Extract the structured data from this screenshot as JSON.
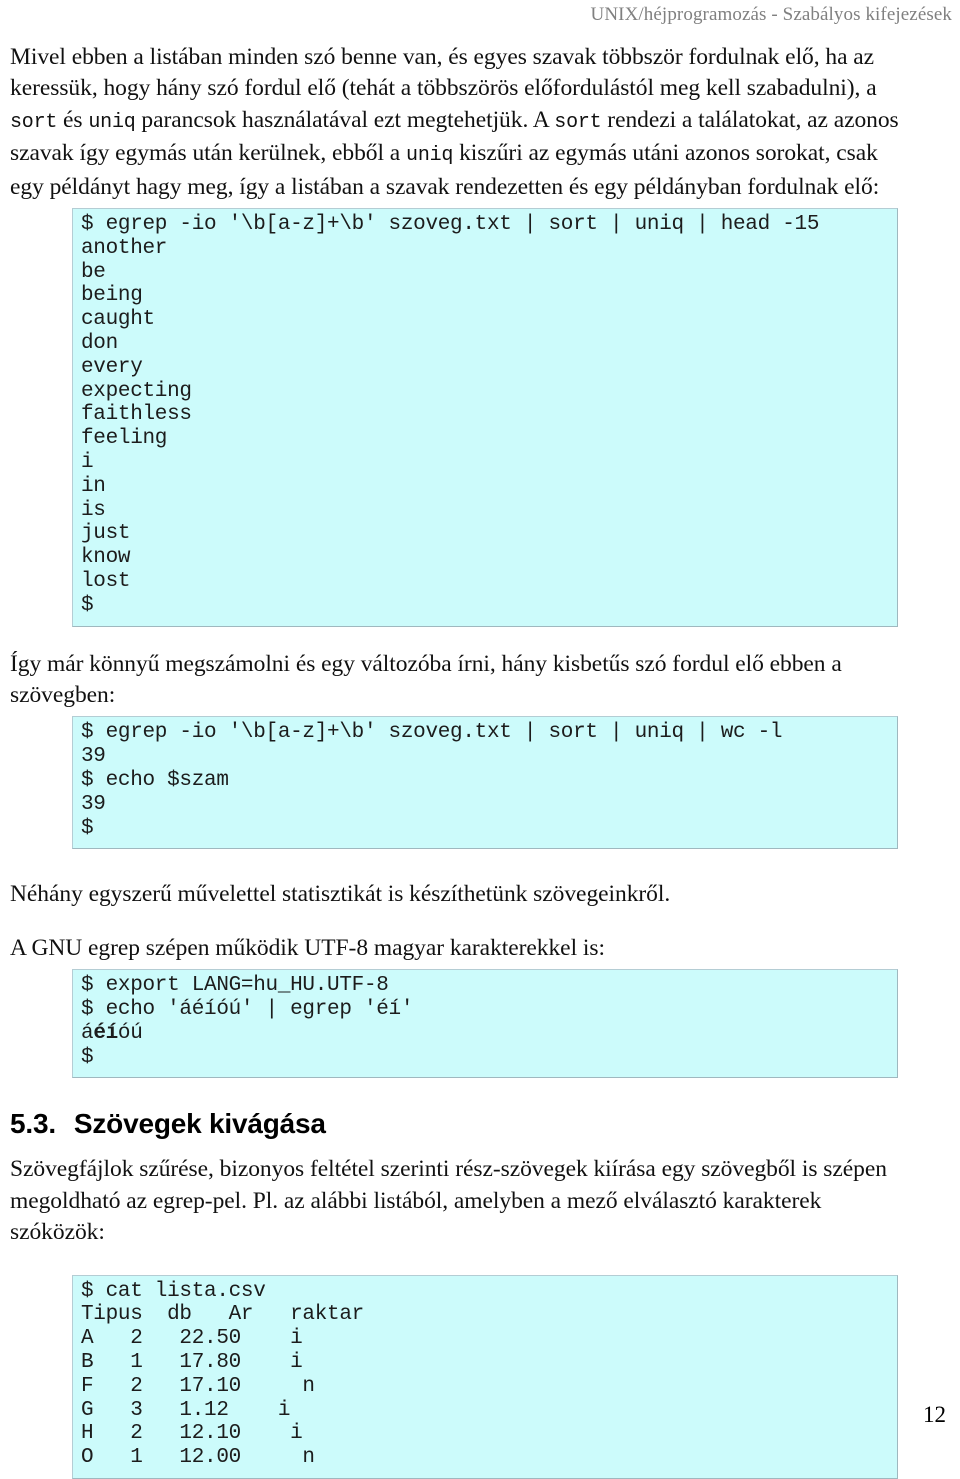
{
  "header": {
    "running_title": "UNIX/héjprogramozás - Szabályos kifejezések"
  },
  "page_number": "12",
  "paragraphs": {
    "intro_part1": "Mivel ebben a listában minden szó benne van, és egyes szavak többször fordulnak elő, ha az keressük, hogy hány szó fordul elő (tehát a többszörös előfordulástól meg kell szabadulni), a ",
    "intro_code1": "sort",
    "intro_part2": " és ",
    "intro_code2": "uniq",
    "intro_part3": " parancsok használatával ezt megtehetjük. A ",
    "intro_code3": "sort",
    "intro_part4": " rendezi a találatokat, az azonos szavak így egymás után kerülnek, ebből a ",
    "intro_code4": "uniq",
    "intro_part5": " kiszűri az egymás utáni azonos sorokat, csak egy példányt hagy meg, így a listában a szavak rendezetten és egy példányban fordulnak elő:",
    "after_first_block": "Így már könnyű megszámolni és egy változóba írni, hány kisbetűs szó fordul elő ebben a szövegben:",
    "after_second_block": "Néhány egyszerű művelettel statisztikát is készíthetünk szövegeinkről.",
    "before_third_block": "A GNU egrep szépen működik UTF-8 magyar karakterekkel is:",
    "section_body": "Szövegfájlok szűrése, bizonyos feltétel szerinti rész-szövegek kiírása egy szövegből is szépen megoldható az egrep-pel. Pl. az alábbi listából, amelyben a mező elválasztó karakterek szóközök:"
  },
  "section": {
    "number": "5.3.",
    "title": "Szövegek kivágása"
  },
  "code_blocks": {
    "block1": {
      "lines": [
        "$ egrep -io '\\b[a-z]+\\b' szoveg.txt | sort | uniq | head -15",
        "another",
        "be",
        "being",
        "caught",
        "don",
        "every",
        "expecting",
        "faithless",
        "feeling",
        "i",
        "in",
        "is",
        "just",
        "know",
        "lost",
        "$"
      ]
    },
    "block2": {
      "lines": [
        "$ egrep -io '\\b[a-z]+\\b' szoveg.txt | sort | uniq | wc -l",
        "39",
        "$ echo $szam",
        "39",
        "$"
      ]
    },
    "block3": {
      "lines": [
        "$ export LANG=hu_HU.UTF-8",
        "$ echo 'áéíóú' | egrep 'éí'",
        "",
        "$"
      ],
      "match_line": {
        "prefix": "á",
        "match": "éí",
        "suffix": "óú"
      }
    },
    "block4": {
      "lines": [
        "$ cat lista.csv",
        "Tipus  db   Ar   raktar",
        "A   2   22.50    i",
        "B   1   17.80    i",
        "F   2   17.10     n",
        "G   3   1.12    i",
        "H   2   12.10    i",
        "O   1   12.00     n"
      ]
    }
  },
  "colors": {
    "code_background": "#ccfbfb",
    "code_border": "#b4cdd4",
    "header_text": "#808080",
    "body_text": "#111111"
  }
}
